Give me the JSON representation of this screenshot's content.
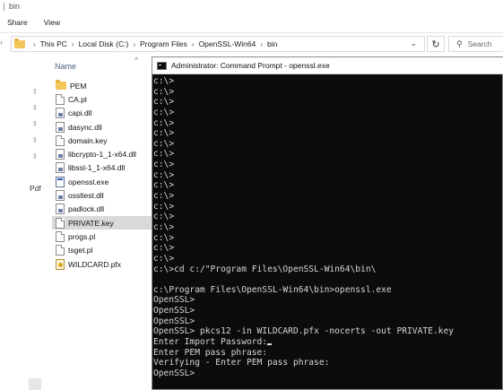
{
  "explorer": {
    "window_title": "bin",
    "ribbon_tabs": [
      "Share",
      "View"
    ],
    "address_path": [
      "This PC",
      "Local Disk (C:)",
      "Program Files",
      "OpenSSL-Win64",
      "bin"
    ],
    "search_placeholder": "Search",
    "column_name": "Name",
    "nav_label": "Pdf",
    "files": [
      {
        "name": "PEM",
        "icon": "folder-icon",
        "selected": false
      },
      {
        "name": "CA.pl",
        "icon": "document-icon",
        "selected": false
      },
      {
        "name": "capi.dll",
        "icon": "dll-file-icon",
        "selected": false
      },
      {
        "name": "dasync.dll",
        "icon": "dll-file-icon",
        "selected": false
      },
      {
        "name": "domain.key",
        "icon": "document-icon",
        "selected": false
      },
      {
        "name": "libcrypto-1_1-x64.dll",
        "icon": "dll-file-icon",
        "selected": false
      },
      {
        "name": "libssl-1_1-x64.dll",
        "icon": "dll-file-icon",
        "selected": false
      },
      {
        "name": "openssl.exe",
        "icon": "exe-file-icon",
        "selected": false
      },
      {
        "name": "ossltest.dll",
        "icon": "dll-file-icon",
        "selected": false
      },
      {
        "name": "padlock.dll",
        "icon": "dll-file-icon",
        "selected": false
      },
      {
        "name": "PRIVATE.key",
        "icon": "document-icon",
        "selected": true
      },
      {
        "name": "progs.pl",
        "icon": "document-icon",
        "selected": false
      },
      {
        "name": "tsget.pl",
        "icon": "document-icon",
        "selected": false
      },
      {
        "name": "WILDCARD.pfx",
        "icon": "certificate-file-icon",
        "selected": false
      }
    ]
  },
  "cmd": {
    "title": "Administrator: Command Prompt - openssl.exe",
    "lines": [
      "c:\\>",
      "c:\\>",
      "c:\\>",
      "c:\\>",
      "c:\\>",
      "c:\\>",
      "c:\\>",
      "c:\\>",
      "c:\\>",
      "c:\\>",
      "c:\\>",
      "c:\\>",
      "c:\\>",
      "c:\\>",
      "c:\\>",
      "c:\\>",
      "c:\\>",
      "c:\\>",
      "c:\\>cd c:/\"Program Files\\OpenSSL-Win64\\bin\\",
      "",
      "c:\\Program Files\\OpenSSL-Win64\\bin>openssl.exe",
      "OpenSSL>",
      "OpenSSL>",
      "OpenSSL>",
      "OpenSSL> pkcs12 -in WILDCARD.pfx -nocerts -out PRIVATE.key",
      "Enter Import Password:",
      "Enter PEM pass phrase:",
      "Verifying - Enter PEM pass phrase:",
      "OpenSSL>"
    ],
    "cursor_line_index": 25
  }
}
